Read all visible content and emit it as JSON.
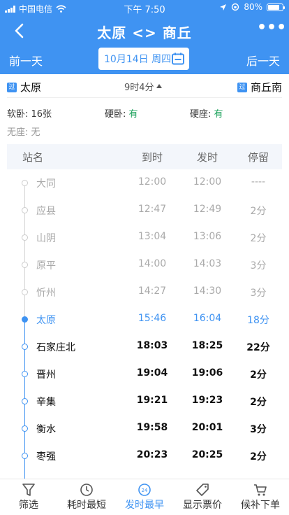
{
  "status": {
    "carrier": "中国电信",
    "time": "下午 7:50",
    "battery": "80%"
  },
  "nav": {
    "title": "太原 <> 商丘",
    "more": "•••"
  },
  "datebar": {
    "prev": "前一天",
    "date": "10月14日 周四",
    "next": "后一天"
  },
  "summary": {
    "from": "太原",
    "to": "商丘南",
    "badge": "过",
    "duration": "9时4分",
    "seats": [
      {
        "label": "软卧: ",
        "value": "16张",
        "available": false
      },
      {
        "label": "硬卧: ",
        "value": "有",
        "available": true
      },
      {
        "label": "硬座: ",
        "value": "有",
        "available": true
      }
    ],
    "no_seat": {
      "label": "无座: ",
      "value": "无"
    }
  },
  "table": {
    "headers": {
      "name": "站名",
      "arrive": "到时",
      "depart": "发时",
      "stop": "停留"
    },
    "rows": [
      {
        "name": "大同",
        "arrive": "12:00",
        "depart": "12:00",
        "stop": "----",
        "state": "past"
      },
      {
        "name": "应县",
        "arrive": "12:47",
        "depart": "12:49",
        "stop": "2分",
        "state": "past"
      },
      {
        "name": "山阴",
        "arrive": "13:04",
        "depart": "13:06",
        "stop": "2分",
        "state": "past"
      },
      {
        "name": "原平",
        "arrive": "14:00",
        "depart": "14:03",
        "stop": "3分",
        "state": "past"
      },
      {
        "name": "忻州",
        "arrive": "14:27",
        "depart": "14:30",
        "stop": "3分",
        "state": "past"
      },
      {
        "name": "太原",
        "arrive": "15:46",
        "depart": "16:04",
        "stop": "18分",
        "state": "cur"
      },
      {
        "name": "石家庄北",
        "arrive": "18:03",
        "depart": "18:25",
        "stop": "22分",
        "state": "next"
      },
      {
        "name": "晋州",
        "arrive": "19:04",
        "depart": "19:06",
        "stop": "2分",
        "state": "next"
      },
      {
        "name": "辛集",
        "arrive": "19:21",
        "depart": "19:23",
        "stop": "2分",
        "state": "next"
      },
      {
        "name": "衡水",
        "arrive": "19:58",
        "depart": "20:01",
        "stop": "3分",
        "state": "next"
      },
      {
        "name": "枣强",
        "arrive": "20:23",
        "depart": "20:25",
        "stop": "2分",
        "state": "next"
      }
    ]
  },
  "toolbar": [
    {
      "label": "筛选",
      "icon": "filter-icon",
      "active": false
    },
    {
      "label": "耗时最短",
      "icon": "clock-icon",
      "active": false
    },
    {
      "label": "发时最早",
      "icon": "24h-icon",
      "active": true,
      "icon_text": "24"
    },
    {
      "label": "显示票价",
      "icon": "price-tag-icon",
      "active": false
    },
    {
      "label": "候补下单",
      "icon": "cart-icon",
      "active": false
    }
  ],
  "colors": {
    "primary": "#3f93f2",
    "available": "#1aa15a",
    "past": "#aaaaaa"
  }
}
